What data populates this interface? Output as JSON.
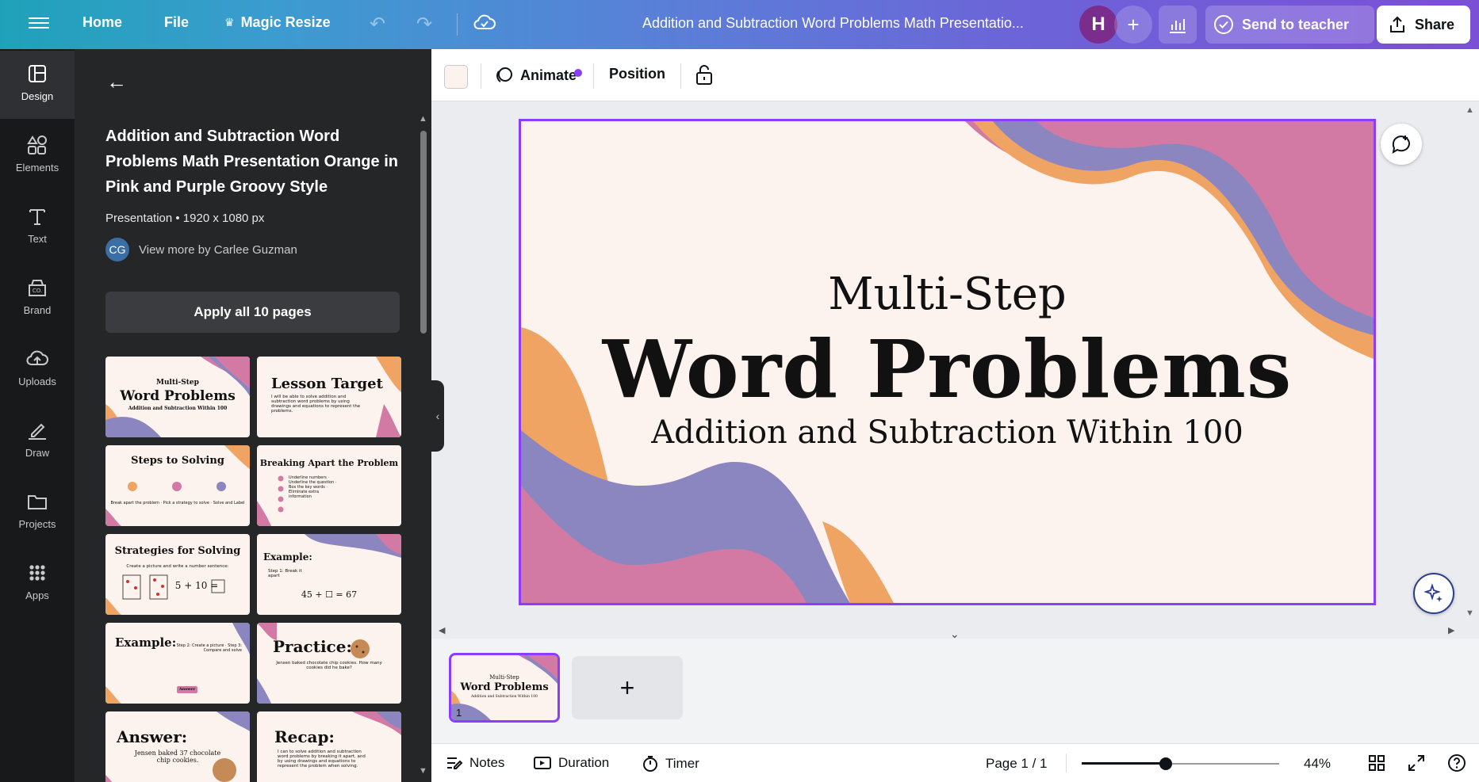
{
  "topbar": {
    "home": "Home",
    "file": "File",
    "magic_resize": "Magic Resize",
    "doc_title": "Addition and Subtraction Word Problems Math Presentatio...",
    "avatar_initial": "H",
    "send_to_teacher": "Send to teacher",
    "share": "Share"
  },
  "rail": {
    "items": [
      {
        "label": "Design",
        "icon": "design-icon"
      },
      {
        "label": "Elements",
        "icon": "elements-icon"
      },
      {
        "label": "Text",
        "icon": "text-icon"
      },
      {
        "label": "Brand",
        "icon": "brand-icon"
      },
      {
        "label": "Uploads",
        "icon": "upload-icon"
      },
      {
        "label": "Draw",
        "icon": "draw-icon"
      },
      {
        "label": "Projects",
        "icon": "folder-icon"
      },
      {
        "label": "Apps",
        "icon": "apps-icon"
      }
    ]
  },
  "panel": {
    "title": "Addition and Subtraction Word Problems Math Presentation Orange in Pink and Purple Groovy Style",
    "meta": "Presentation • 1920 x 1080 px",
    "author_initials": "CG",
    "author_link": "View more by Carlee Guzman",
    "apply_button": "Apply all 10 pages",
    "thumbs": [
      {
        "title": "Multi-Step",
        "title2": "Word Problems",
        "sub": "Addition and Subtraction Within 100"
      },
      {
        "title": "Lesson Target",
        "sub": "I will be able to solve addition and subtraction word problems by using drawings and equations to represent the problems."
      },
      {
        "title": "Steps to Solving",
        "sub": "Break apart the problem · Pick a strategy to solve · Solve and Label"
      },
      {
        "title": "Breaking Apart the Problem",
        "sub": "Underline numbers · Underline the question · Box the key words · Eliminate extra information"
      },
      {
        "title": "Strategies for Solving",
        "sub": "Create a picture and write a number sentence:",
        "eq": "5 + 10 ="
      },
      {
        "title": "Example:",
        "sub": "Step 1: Break it apart",
        "eq": "45 + ☐ = 67"
      },
      {
        "title": "Example:",
        "sub": "Step 2: Create a picture · Step 3: Compare and solve",
        "badge": "Answer"
      },
      {
        "title": "Practice:",
        "sub": "Jensen baked chocolate chip cookies. How many cookies did he bake?"
      },
      {
        "title": "Answer:",
        "sub": "Jensen baked 37 chocolate chip cookies."
      },
      {
        "title": "Recap:",
        "sub": "I can to solve addition and subtraction word problems by breaking it apart, and by using drawings and equations to represent the problem when solving."
      }
    ]
  },
  "editor": {
    "animate": "Animate",
    "position": "Position",
    "bg_color": "#fdf3ee"
  },
  "slide": {
    "pre_title": "Multi-Step",
    "main_title": "Word Problems",
    "subtitle": "Addition and Subtraction Within 100",
    "colors": {
      "pink": "#d27aa4",
      "orange": "#f0a463",
      "purple": "#8b86c0",
      "bg": "#fdf3ee"
    }
  },
  "pages": {
    "current_page_number": "1",
    "thumb_pre": "Multi-Step",
    "thumb_main": "Word Problems",
    "thumb_sub": "Addition and Subtraction Within 100",
    "add_page": "+"
  },
  "footer": {
    "notes": "Notes",
    "duration": "Duration",
    "timer": "Timer",
    "page_indicator": "Page 1 / 1",
    "zoom": "44%",
    "zoom_level": 0.44
  },
  "accent": "#8b3dff"
}
